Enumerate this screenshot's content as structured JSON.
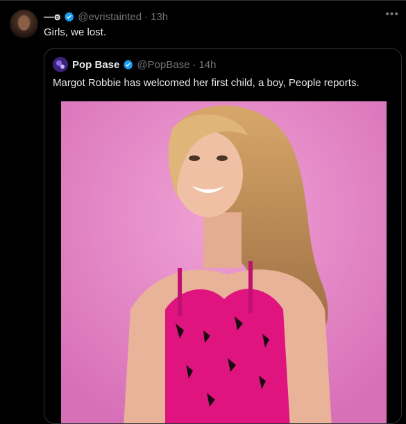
{
  "tweet": {
    "display_name": "—ꙩ",
    "handle": "@evristainted",
    "separator": "·",
    "time": "13h",
    "text": "Girls, we lost.",
    "more_icon": "ellipsis-icon"
  },
  "quote": {
    "display_name": "Pop Base",
    "handle": "@PopBase",
    "separator": "·",
    "time": "14h",
    "text": "Margot Robbie has welcomed her first child, a boy, People reports."
  },
  "colors": {
    "verified": "#1d9bf0",
    "muted": "#71767b",
    "text": "#e7e9ea",
    "media_background": "#e27fc2",
    "dress": "#e0147f"
  }
}
